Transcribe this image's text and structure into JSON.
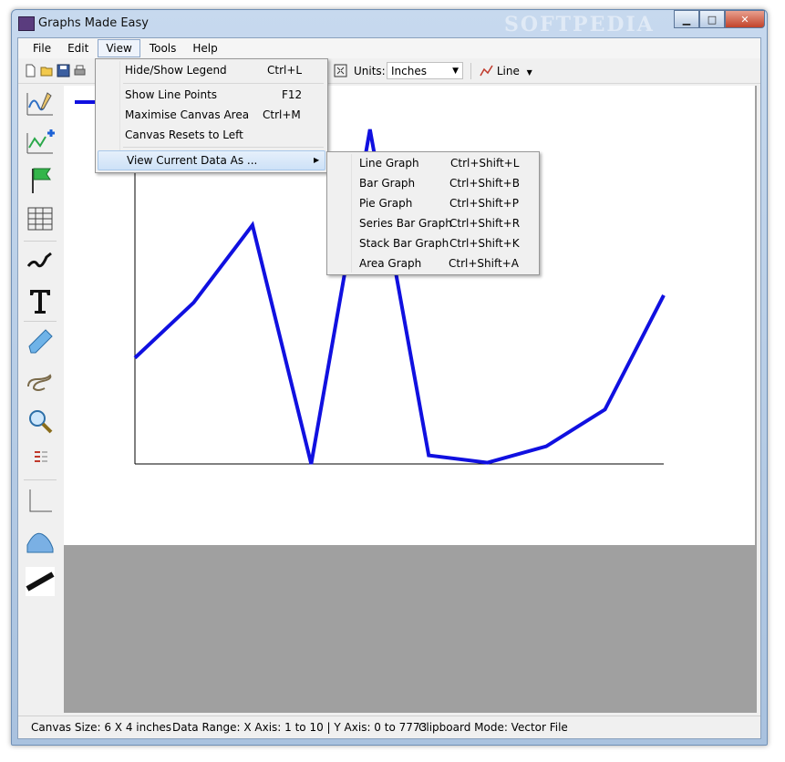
{
  "window": {
    "title": "Graphs Made Easy",
    "watermark": "SOFTPEDIA",
    "minimize_glyph": "▁",
    "maximize_glyph": "□",
    "close_glyph": "✕"
  },
  "menubar": {
    "items": [
      {
        "label": "File"
      },
      {
        "label": "Edit"
      },
      {
        "label": "View"
      },
      {
        "label": "Tools"
      },
      {
        "label": "Help"
      }
    ]
  },
  "toolbar": {
    "units_label": "Units:",
    "units_value": "Inches",
    "dropdown_arrow": "▼",
    "line_label": "Line",
    "line_arrow": "▼",
    "icons": [
      "new-icon",
      "open-icon",
      "save-icon",
      "print-icon",
      "fit-canvas-icon",
      "line-graph-icon"
    ]
  },
  "left_tools": [
    "draw-graph-icon",
    "add-point-icon",
    "flag-icon",
    "grid-icon",
    "trend-icon",
    "text-icon",
    "eraser-icon",
    "freehand-icon",
    "zoom-icon",
    "legend-icon",
    "axes-icon",
    "area-icon",
    "line-thickness-icon"
  ],
  "view_menu": {
    "items": [
      {
        "label": "Hide/Show Legend",
        "shortcut": "Ctrl+L"
      },
      {
        "label": "Show Line Points",
        "shortcut": "F12"
      },
      {
        "label": "Maximise Canvas Area",
        "shortcut": "Ctrl+M"
      },
      {
        "label": "Canvas Resets to Left",
        "shortcut": ""
      },
      {
        "label": "View Current Data As ...",
        "shortcut": "",
        "submenu_arrow": "▶"
      }
    ]
  },
  "submenu": {
    "items": [
      {
        "label": "Line Graph",
        "shortcut": "Ctrl+Shift+L"
      },
      {
        "label": "Bar Graph",
        "shortcut": "Ctrl+Shift+B"
      },
      {
        "label": "Pie Graph",
        "shortcut": "Ctrl+Shift+P"
      },
      {
        "label": "Series Bar Graph",
        "shortcut": "Ctrl+Shift+R"
      },
      {
        "label": "Stack Bar Graph",
        "shortcut": "Ctrl+Shift+K"
      },
      {
        "label": "Area Graph",
        "shortcut": "Ctrl+Shift+A"
      }
    ]
  },
  "statusbar": {
    "canvas_size": "Canvas Size:  6 X 4  inches",
    "data_range": "Data Range:  X Axis: 1 to 10  |  Y Axis: 0 to  7773",
    "clipboard": "Clipboard Mode: Vector File"
  },
  "colors": {
    "series": "#1010e0",
    "canvas_bg": "#ffffff",
    "workspace_bg": "#a0a0a0"
  },
  "chart_data": {
    "type": "line",
    "x": [
      1,
      2,
      3,
      4,
      5,
      6,
      7,
      8,
      9,
      10
    ],
    "series": [
      {
        "values": [
          2465,
          3750,
          5550,
          0,
          7773,
          200,
          30,
          410,
          1265,
          3920
        ]
      }
    ],
    "xlim": [
      1,
      10
    ],
    "ylim": [
      0,
      7773
    ],
    "grid": false,
    "legend": "top-left"
  }
}
